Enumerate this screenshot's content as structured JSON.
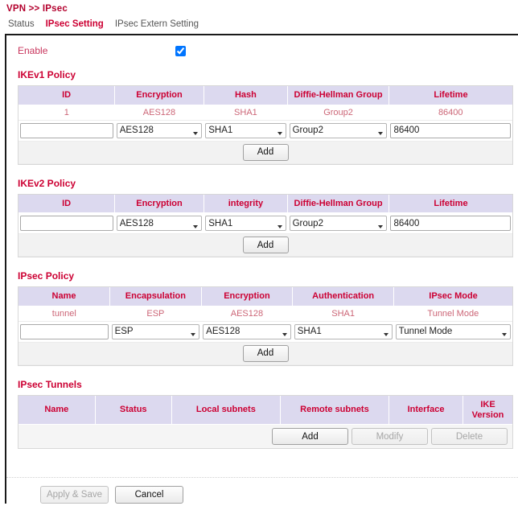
{
  "breadcrumb": "VPN >> IPsec",
  "tabs": [
    {
      "label": "Status",
      "state": "inactive"
    },
    {
      "label": "IPsec Setting",
      "state": "active"
    },
    {
      "label": "IPsec Extern Setting",
      "state": "inactive-dark"
    }
  ],
  "enable": {
    "label": "Enable",
    "checked": true
  },
  "ikev1": {
    "title": "IKEv1 Policy",
    "columns": [
      "ID",
      "Encryption",
      "Hash",
      "Diffie-Hellman Group",
      "Lifetime"
    ],
    "rows": [
      {
        "id": "1",
        "encryption": "AES128",
        "hash": "SHA1",
        "dh": "Group2",
        "lifetime": "86400"
      }
    ],
    "form": {
      "id_value": "",
      "encryption_value": "AES128",
      "encryption_options": [
        "AES128"
      ],
      "hash_value": "SHA1",
      "hash_options": [
        "SHA1"
      ],
      "dh_value": "Group2",
      "dh_options": [
        "Group2"
      ],
      "lifetime_value": "86400"
    },
    "add_label": "Add"
  },
  "ikev2": {
    "title": "IKEv2 Policy",
    "columns": [
      "ID",
      "Encryption",
      "integrity",
      "Diffie-Hellman Group",
      "Lifetime"
    ],
    "rows": [],
    "form": {
      "id_value": "",
      "encryption_value": "AES128",
      "encryption_options": [
        "AES128"
      ],
      "integrity_value": "SHA1",
      "integrity_options": [
        "SHA1"
      ],
      "dh_value": "Group2",
      "dh_options": [
        "Group2"
      ],
      "lifetime_value": "86400"
    },
    "add_label": "Add"
  },
  "ipsec_policy": {
    "title": "IPsec Policy",
    "columns": [
      "Name",
      "Encapsulation",
      "Encryption",
      "Authentication",
      "IPsec Mode"
    ],
    "rows": [
      {
        "name": "tunnel",
        "encapsulation": "ESP",
        "encryption": "AES128",
        "authentication": "SHA1",
        "mode": "Tunnel Mode"
      }
    ],
    "form": {
      "name_value": "",
      "encapsulation_value": "ESP",
      "encapsulation_options": [
        "ESP"
      ],
      "encryption_value": "AES128",
      "encryption_options": [
        "AES128"
      ],
      "authentication_value": "SHA1",
      "authentication_options": [
        "SHA1"
      ],
      "mode_value": "Tunnel Mode",
      "mode_options": [
        "Tunnel Mode"
      ]
    },
    "add_label": "Add"
  },
  "ipsec_tunnels": {
    "title": "IPsec Tunnels",
    "columns": [
      "Name",
      "Status",
      "Local subnets",
      "Remote subnets",
      "Interface",
      "IKE Version"
    ],
    "rows": [],
    "actions": {
      "add_label": "Add",
      "modify_label": "Modify",
      "delete_label": "Delete",
      "modify_disabled": true,
      "delete_disabled": true
    }
  },
  "footer": {
    "apply_label": "Apply & Save",
    "apply_disabled": true,
    "cancel_label": "Cancel"
  },
  "colors": {
    "accent_red": "#cc0033",
    "header_bg": "#dcd9ef",
    "data_text": "#cc6677"
  }
}
